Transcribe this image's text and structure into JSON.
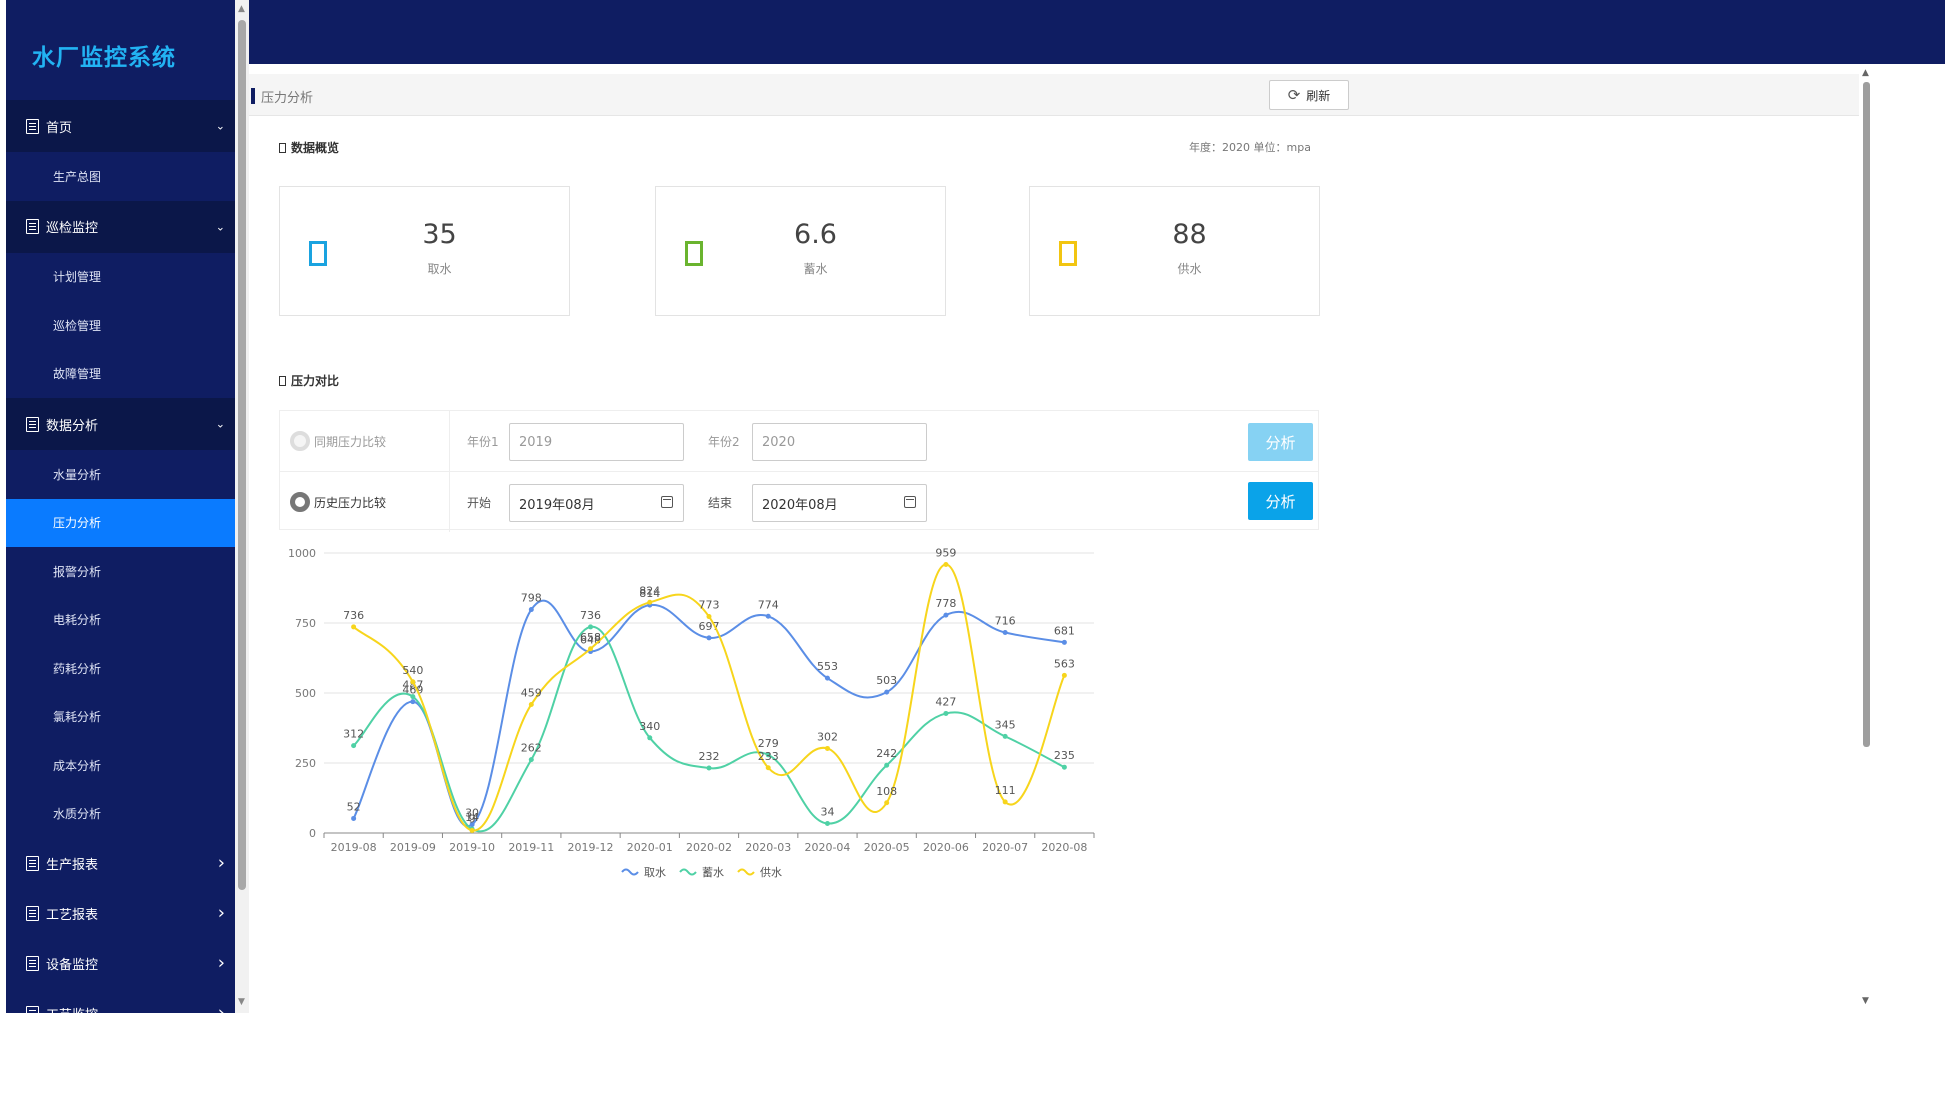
{
  "app": {
    "title": "水厂监控系统"
  },
  "sidebar": {
    "groups": [
      {
        "label": "首页",
        "expanded": true,
        "items": [
          "生产总图"
        ]
      },
      {
        "label": "巡检监控",
        "expanded": true,
        "items": [
          "计划管理",
          "巡检管理",
          "故障管理"
        ]
      },
      {
        "label": "数据分析",
        "expanded": true,
        "items": [
          "水量分析",
          "压力分析",
          "报警分析",
          "电耗分析",
          "药耗分析",
          "氯耗分析",
          "成本分析",
          "水质分析"
        ]
      },
      {
        "label": "生产报表",
        "expanded": false,
        "items": []
      },
      {
        "label": "工艺报表",
        "expanded": false,
        "items": []
      },
      {
        "label": "设备监控",
        "expanded": false,
        "items": []
      },
      {
        "label": "工艺监控",
        "expanded": false,
        "items": []
      }
    ],
    "active_item": "压力分析"
  },
  "breadcrumb": {
    "title": "压力分析",
    "refresh_label": "刷新"
  },
  "overview": {
    "title": "数据概览",
    "meta": "年度：2020  单位：mpa",
    "cards": [
      {
        "value": "35",
        "label": "取水",
        "color": "#1aa3e0"
      },
      {
        "value": "6.6",
        "label": "蓄水",
        "color": "#6ab42f"
      },
      {
        "value": "88",
        "label": "供水",
        "color": "#f2c511"
      }
    ]
  },
  "compare": {
    "title": "压力对比",
    "row1": {
      "radio_label": "同期压力比较",
      "label1": "年份1",
      "value1": "2019",
      "label2": "年份2",
      "value2": "2020",
      "button": "分析"
    },
    "row2": {
      "radio_label": "历史压力比较",
      "label1": "开始",
      "value1": "2019年08月",
      "label2": "结束",
      "value2": "2020年08月",
      "button": "分析"
    }
  },
  "chart_data": {
    "type": "line",
    "categories": [
      "2019-08",
      "2019-09",
      "2019-10",
      "2019-11",
      "2019-12",
      "2020-01",
      "2020-02",
      "2020-03",
      "2020-04",
      "2020-05",
      "2020-06",
      "2020-07",
      "2020-08"
    ],
    "ylim": [
      0,
      1000
    ],
    "yticks": [
      0,
      250,
      500,
      750,
      1000
    ],
    "grid": true,
    "legend": "bottom-center",
    "series": [
      {
        "name": "取水",
        "color": "#5b8ee6",
        "values": [
          52,
          469,
          30,
          798,
          648,
          814,
          697,
          774,
          553,
          503,
          778,
          716,
          681
        ]
      },
      {
        "name": "蓄水",
        "color": "#4fd1a5",
        "values": [
          312,
          487,
          14,
          262,
          736,
          340,
          232,
          279,
          34,
          242,
          427,
          345,
          235
        ]
      },
      {
        "name": "供水",
        "color": "#f7d51c",
        "values": [
          736,
          540,
          9,
          459,
          658,
          824,
          773,
          233,
          302,
          108,
          959,
          111,
          563
        ]
      }
    ]
  }
}
